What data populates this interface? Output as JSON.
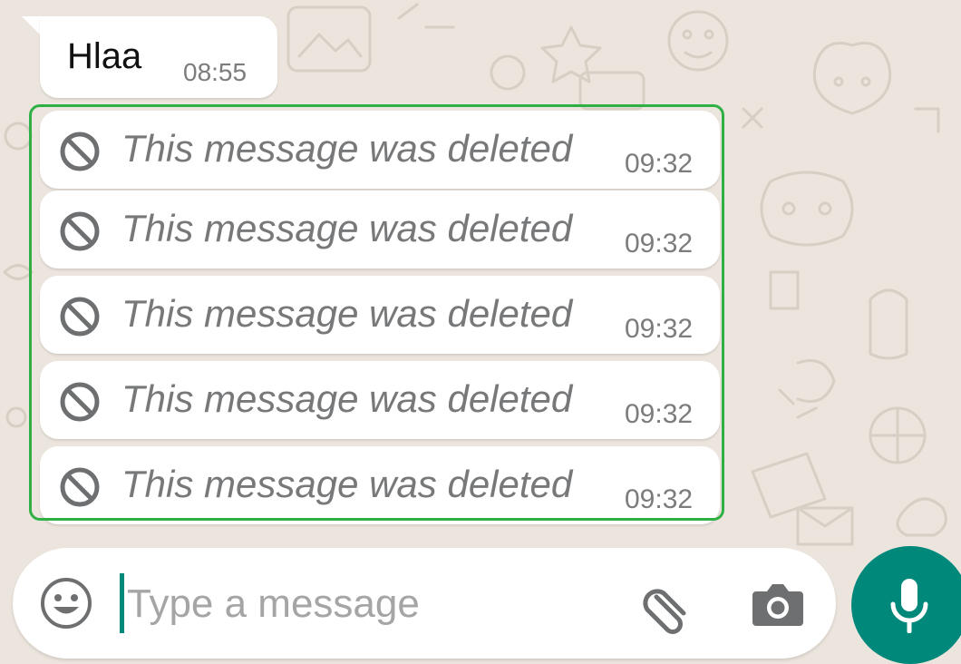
{
  "chat": {
    "messages": [
      {
        "text": "Hlaa",
        "time": "08:55"
      }
    ],
    "deleted_messages": [
      {
        "text": "This message was deleted",
        "time": "09:32"
      },
      {
        "text": "This message was deleted",
        "time": "09:32"
      },
      {
        "text": "This message was deleted",
        "time": "09:32"
      },
      {
        "text": "This message was deleted",
        "time": "09:32"
      },
      {
        "text": "This message was deleted",
        "time": "09:32"
      }
    ]
  },
  "composer": {
    "placeholder": "Type a message",
    "value": "",
    "icons": {
      "emoji": "emoji-icon",
      "attach": "paperclip-icon",
      "camera": "camera-icon",
      "mic": "microphone-icon"
    }
  },
  "colors": {
    "background": "#ece5dd",
    "bubble": "#ffffff",
    "selection_border": "#2fb045",
    "accent": "#00897b",
    "icon_gray": "#6d6f71"
  }
}
